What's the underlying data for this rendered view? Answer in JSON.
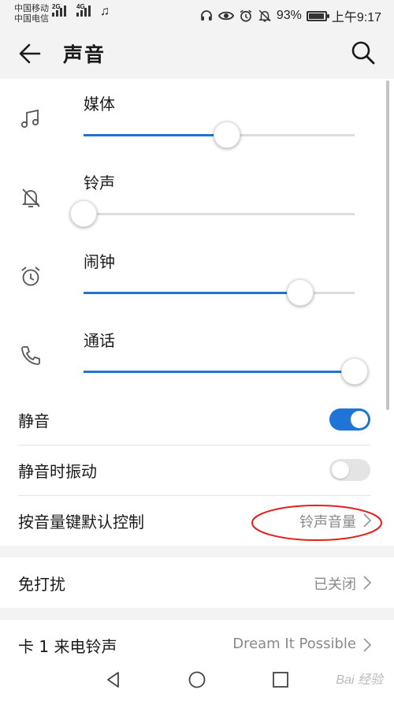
{
  "status": {
    "carrier1": "中国移动",
    "carrier2": "中国电信",
    "sig1_tag": "2G",
    "sig2_tag": "4G",
    "battery": "93%",
    "time": "上午9:17"
  },
  "header": {
    "title": "声音"
  },
  "volumes": [
    {
      "label": "媒体",
      "icon": "music-note-icon",
      "level": 0.53
    },
    {
      "label": "铃声",
      "icon": "bell-off-icon",
      "level": 0.0
    },
    {
      "label": "闹钟",
      "icon": "alarm-clock-icon",
      "level": 0.8
    },
    {
      "label": "通话",
      "icon": "phone-icon",
      "level": 1.0
    }
  ],
  "settings": {
    "mute": {
      "label": "静音",
      "on": true
    },
    "vibrate_on_mute": {
      "label": "静音时振动",
      "on": false
    },
    "volume_key": {
      "label": "按音量键默认控制",
      "value": "铃声音量"
    },
    "dnd": {
      "label": "免打扰",
      "value": "已关闭"
    },
    "sim1_ringtone": {
      "label": "卡 1 来电铃声",
      "value": "Dream It Possible"
    }
  },
  "watermark": "Bai 经验",
  "colors": {
    "accent": "#1f74d6",
    "annotation": "#e0201b"
  }
}
